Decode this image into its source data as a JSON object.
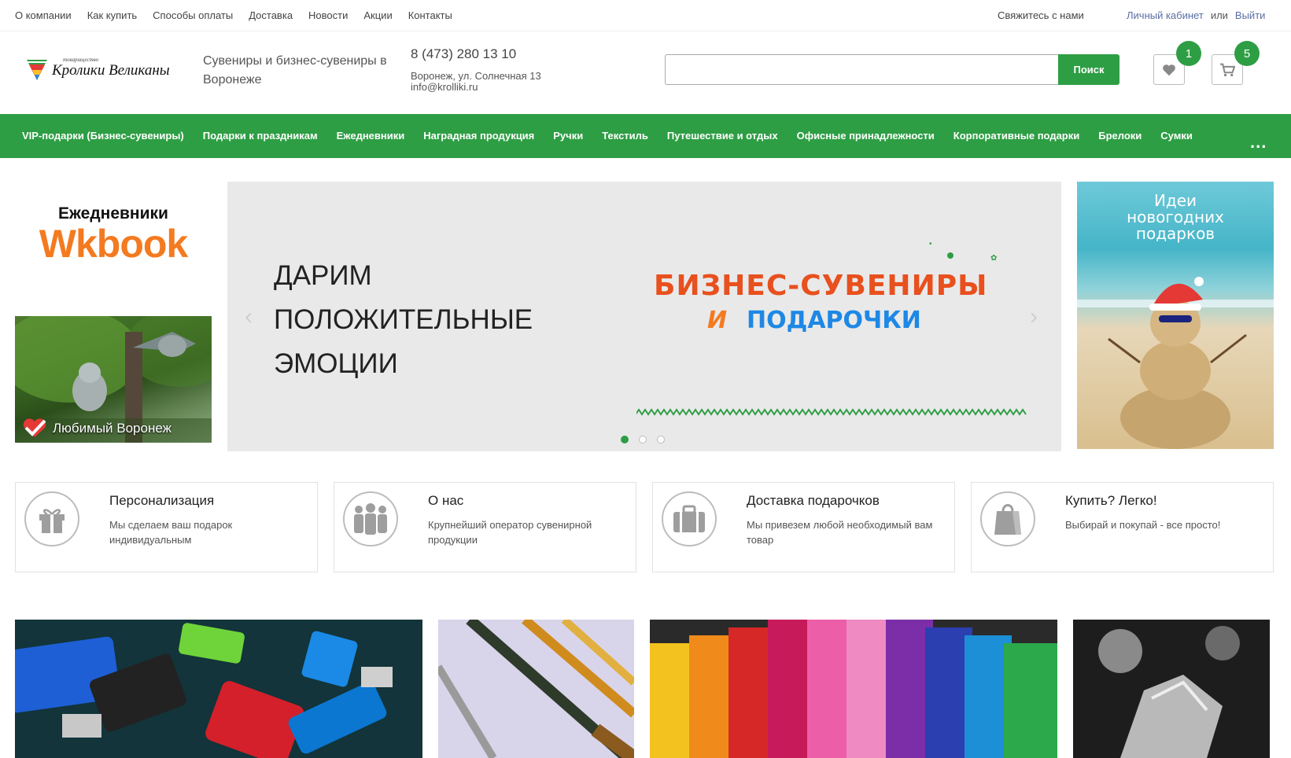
{
  "topbar": {
    "nav": [
      "О компании",
      "Как купить",
      "Способы оплаты",
      "Доставка",
      "Новости",
      "Акции",
      "Контакты"
    ],
    "contact": "Свяжитесь с нами",
    "account": {
      "cabinet": "Личный кабинет",
      "or": "или",
      "logout": "Выйти"
    }
  },
  "header": {
    "logo_tag": "товарищество",
    "logo_text": "Кролики Великаны",
    "tagline": "Сувениры и бизнес-сувениры в Воронеже",
    "phone": "8 (473) 280 13 10",
    "address": "Воронеж, ул. Солнечная 13",
    "email": "info@krolliki.ru",
    "search": {
      "placeholder": "",
      "button": "Поиск"
    },
    "wishlist_count": "1",
    "cart_count": "5"
  },
  "mainnav": {
    "items": [
      "VIP-подарки (Бизнес-сувениры)",
      "Подарки к праздникам",
      "Ежедневники",
      "Наградная продукция",
      "Ручки",
      "Текстиль",
      "Путешествие и отдых",
      "Офисные принадлежности",
      "Корпоративные подарки",
      "Брелоки",
      "Сумки"
    ],
    "more": "..."
  },
  "banners": {
    "left_top": {
      "sub": "Ежедневники",
      "main": "Wkbook"
    },
    "left_bottom": "Любимый Воронеж",
    "slider": {
      "headline": [
        "ДАРИМ",
        "ПОЛОЖИТЕЛЬНЫЕ",
        "ЭМОЦИИ"
      ],
      "art_line1": "БИЗНЕС-СУВЕНИРЫ",
      "art_line2_a": "И",
      "art_line2_b": "ПОДАРОЧКИ",
      "prev": "‹",
      "next": "›",
      "slides": 3,
      "active": 0
    },
    "right": [
      "Идеи",
      "новогодних",
      "подарков"
    ]
  },
  "features": [
    {
      "title": "Персонализация",
      "desc": "Мы сделаем ваш подарок индивидуальным",
      "icon": "gift-icon"
    },
    {
      "title": "О нас",
      "desc": "Крупнейший оператор сувенирной продукции",
      "icon": "people-icon"
    },
    {
      "title": "Доставка подарочков",
      "desc": "Мы привезем любой необходимый вам товар",
      "icon": "suitcase-icon"
    },
    {
      "title": "Купить? Легко!",
      "desc": "Выбирай и покупай - все просто!",
      "icon": "shopping-bag-icon"
    }
  ],
  "colors": {
    "brand_green": "#2e9e44",
    "accent_orange": "#f47a20",
    "link_blue": "#5a6fa3"
  }
}
